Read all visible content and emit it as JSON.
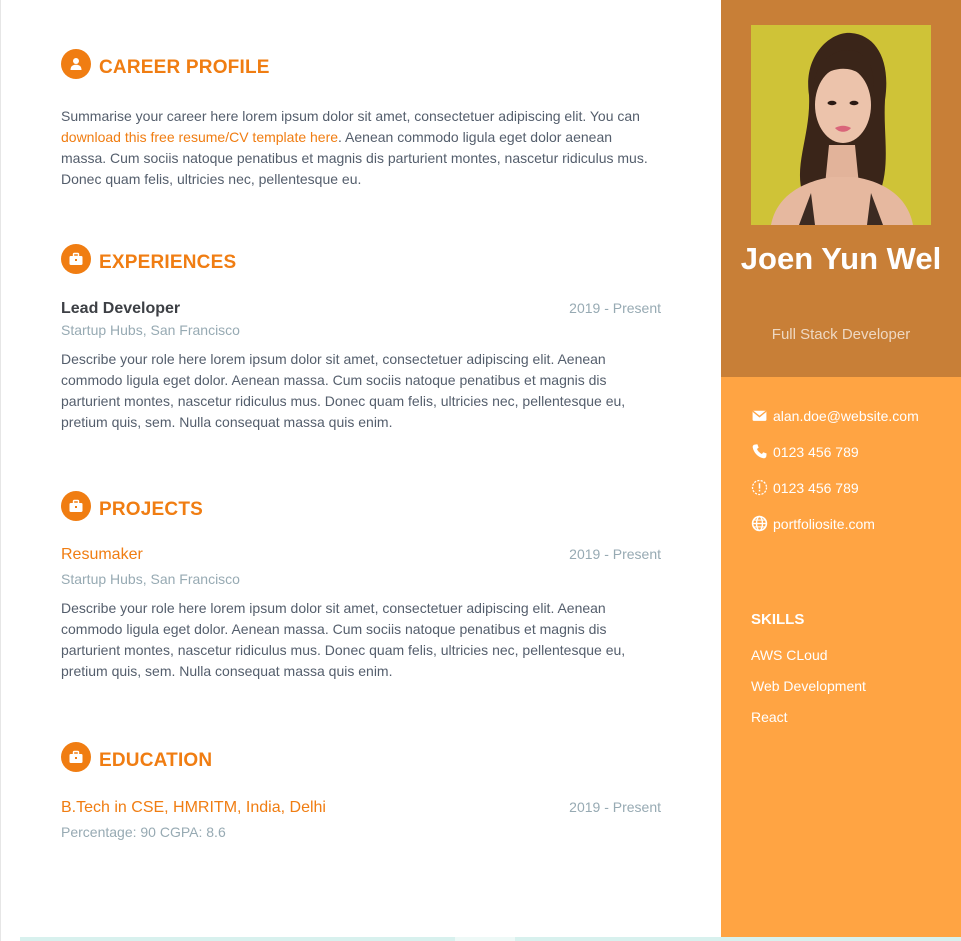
{
  "career": {
    "title": "CAREER PROFILE",
    "text_before": "Summarise your career here lorem ipsum dolor sit amet, consectetuer adipiscing elit. You can ",
    "link_text": "download this free resume/CV template here",
    "text_after": ". Aenean commodo ligula eget dolor aenean massa. Cum sociis natoque penatibus et magnis dis parturient montes, nascetur ridiculus mus. Donec quam felis, ultricies nec, pellentesque eu."
  },
  "experiences": {
    "title": "EXPERIENCES",
    "items": [
      {
        "role": "Lead Developer",
        "time": "2019 - Present",
        "company": "Startup Hubs, San Francisco",
        "description": "Describe your role here lorem ipsum dolor sit amet, consectetuer adipiscing elit. Aenean commodo ligula eget dolor. Aenean massa. Cum sociis natoque penatibus et magnis dis parturient montes, nascetur ridiculus mus. Donec quam felis, ultricies nec, pellentesque eu, pretium quis, sem. Nulla consequat massa quis enim."
      }
    ]
  },
  "projects": {
    "title": "PROJECTS",
    "items": [
      {
        "name": "Resumaker",
        "time": "2019 - Present",
        "company": "Startup Hubs, San Francisco",
        "description": "Describe your role here lorem ipsum dolor sit amet, consectetuer adipiscing elit. Aenean commodo ligula eget dolor. Aenean massa. Cum sociis natoque penatibus et magnis dis parturient montes, nascetur ridiculus mus. Donec quam felis, ultricies nec, pellentesque eu, pretium quis, sem. Nulla consequat massa quis enim."
      }
    ]
  },
  "education": {
    "title": "EDUCATION",
    "items": [
      {
        "degree": "B.Tech in CSE, HMRITM, India, Delhi",
        "time": "2019 - Present",
        "details": "Percentage: 90 CGPA: 8.6"
      }
    ]
  },
  "sidebar": {
    "name": "Joen Yun Wel",
    "tagline": "Full Stack Developer",
    "contacts": [
      {
        "icon": "envelope-icon",
        "text": "alan.doe@website.com"
      },
      {
        "icon": "phone-icon",
        "text": "0123 456 789"
      },
      {
        "icon": "alert-circle-icon",
        "text": "0123 456 789"
      },
      {
        "icon": "globe-icon",
        "text": "portfoliosite.com"
      }
    ],
    "skills_title": "SKILLS",
    "skills": [
      "AWS CLoud",
      "Web Development",
      "React"
    ]
  },
  "colors": {
    "accent": "#f07d12",
    "sidebar_top": "#c87f37",
    "sidebar_bottom": "#ffa443",
    "body_text": "#545e6c",
    "muted_text": "#97aab3"
  }
}
